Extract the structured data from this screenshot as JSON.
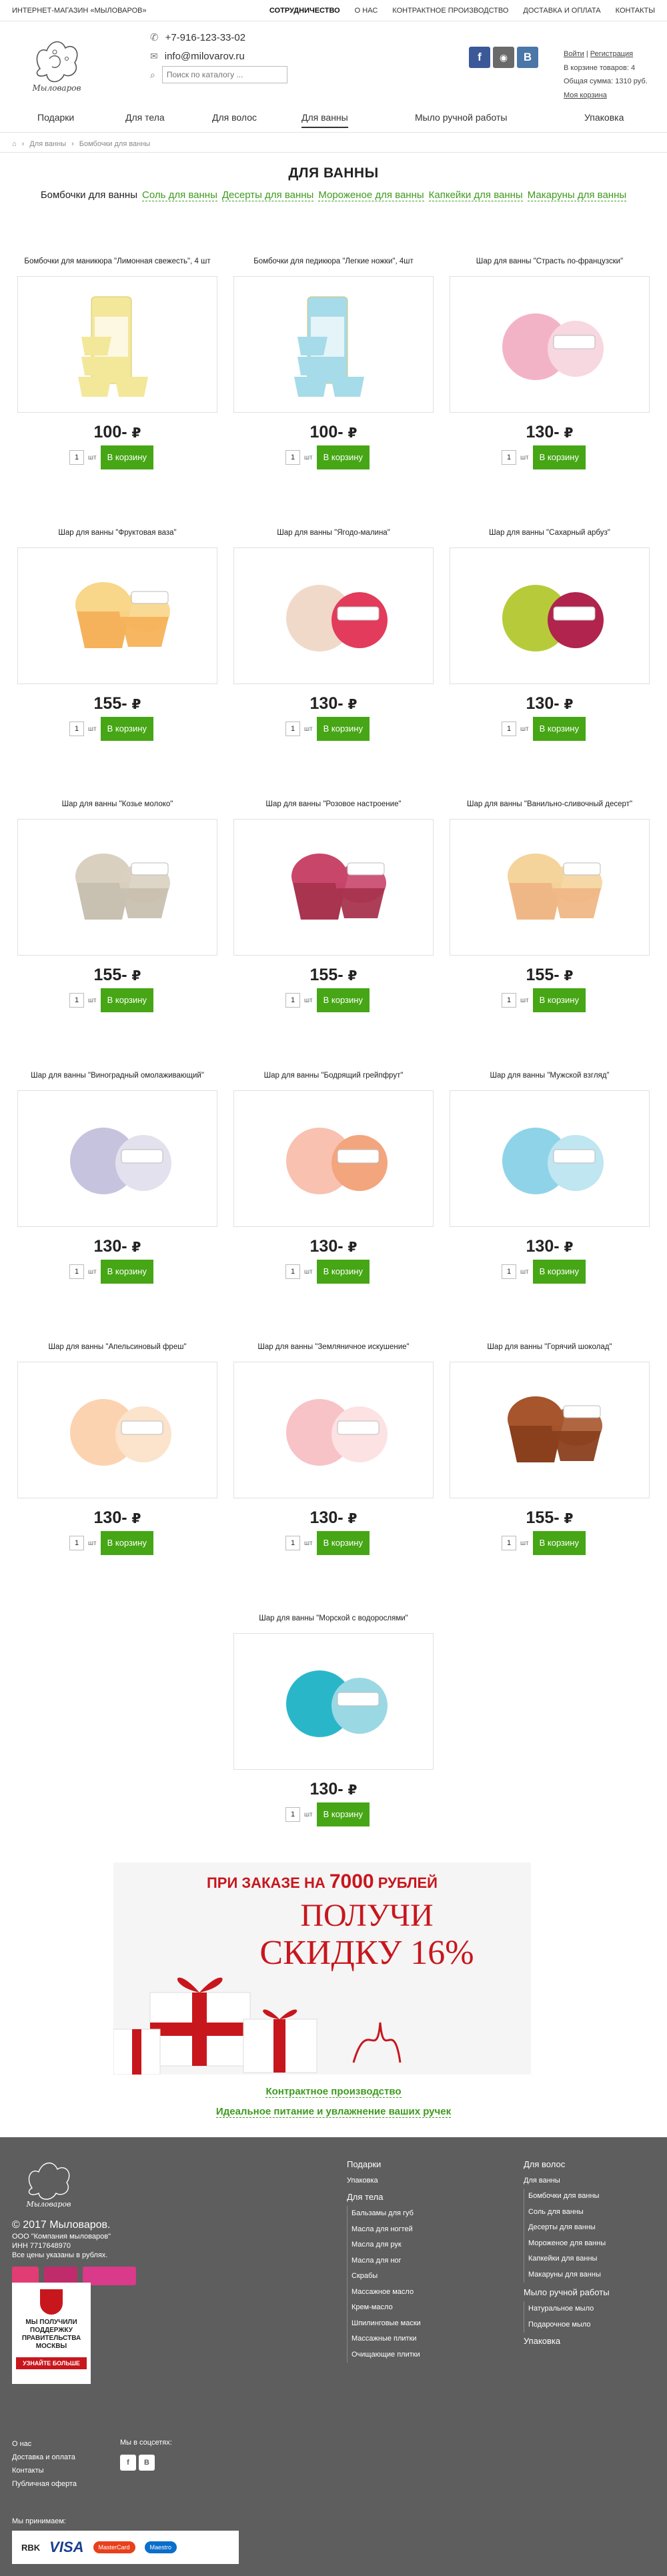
{
  "topbar": {
    "shop_name": "ИНТЕРНЕТ-МАГАЗИН «МЫЛОВАРОВ»",
    "nav": [
      "СОТРУДНИЧЕСТВО",
      "О НАС",
      "КОНТРАКТНОЕ ПРОИЗВОДСТВО",
      "ДОСТАВКА И ОПЛАТА",
      "КОНТАКТЫ"
    ]
  },
  "header": {
    "phone": "+7-916-123-33-02",
    "email": "info@milovarov.ru",
    "search_placeholder": "Поиск по каталогу ...",
    "login": "Войти",
    "register": "Регистрация",
    "cart_count": "В корзине товаров: 4",
    "cart_sum": "Общая сумма: 1310 руб.",
    "my_cart": "Моя корзина",
    "logo_text": "Мыловаров"
  },
  "mainnav": [
    "Подарки",
    "Для тела",
    "Для волос",
    "Для ванны",
    "Мыло ручной работы",
    "Упаковка"
  ],
  "breadcrumb": [
    "Для ванны",
    "Бомбочки для ванны"
  ],
  "page_title": "ДЛЯ ВАННЫ",
  "subnav": [
    "Бомбочки для ванны",
    "Соль для ванны",
    "Десерты для ванны",
    "Мороженое для ванны",
    "Капкейки для ванны",
    "Макаруны для ванны"
  ],
  "buy_label": "В корзину",
  "qty_default": "1",
  "unit_label": "шт",
  "currency": "₽",
  "products": [
    {
      "title": "Бомбочки для маникюра \"Лимонная свежесть\", 4 шт",
      "price": "100-"
    },
    {
      "title": "Бомбочки для педикюра \"Легкие ножки\", 4шт",
      "price": "100-"
    },
    {
      "title": "Шар для ванны \"Страсть по-французски\"",
      "price": "130-"
    },
    {
      "title": "Шар для ванны \"Фруктовая ваза\"",
      "price": "155-"
    },
    {
      "title": "Шар для ванны \"Ягодо-малина\"",
      "price": "130-"
    },
    {
      "title": "Шар для ванны \"Сахарный арбуз\"",
      "price": "130-"
    },
    {
      "title": "Шар для ванны \"Козье молоко\"",
      "price": "155-"
    },
    {
      "title": "Шар для ванны \"Розовое настроение\"",
      "price": "155-"
    },
    {
      "title": "Шар для ванны \"Ванильно-сливочный десерт\"",
      "price": "155-"
    },
    {
      "title": "Шар для ванны \"Виноградный омолаживающий\"",
      "price": "130-"
    },
    {
      "title": "Шар для ванны \"Бодрящий грейпфрут\"",
      "price": "130-"
    },
    {
      "title": "Шар для ванны \"Мужской взгляд\"",
      "price": "130-"
    },
    {
      "title": "Шар для ванны \"Апельсиновый фреш\"",
      "price": "130-"
    },
    {
      "title": "Шар для ванны \"Земляничное искушение\"",
      "price": "130-"
    },
    {
      "title": "Шар для ванны \"Горячий шоколад\"",
      "price": "155-"
    },
    {
      "title": "Шар для ванны \"Морской с водорослями\"",
      "price": "130-"
    }
  ],
  "banner": {
    "line1": "ПРИ ЗАКАЗЕ НА",
    "amount": "7000",
    "line1b": "РУБЛЕЙ",
    "line2": "ПОЛУЧИ",
    "line3": "СКИДКУ",
    "percent": "16%"
  },
  "bottom_links": [
    "Контрактное производство",
    "Идеальное питание и увлажнение ваших ручек"
  ],
  "footer": {
    "copyright": "© 2017 Мыловаров.",
    "company": "ООО \"Компания мыловаров\"",
    "inn": "ИНН 7717648970",
    "prices_note": "Все цены указаны в рублях.",
    "badge": "МЫ ПОЛУЧИЛИ ПОДДЕРЖКУ ПРАВИТЕЛЬСТВА МОСКВЫ",
    "badge_btn": "УЗНАЙТЕ БОЛЬШЕ",
    "bottom_links": [
      "О нас",
      "Доставка и оплата",
      "Контакты",
      "Публичная оферта"
    ],
    "social_title": "Мы в соцсетях:",
    "payments_title": "Мы принимаем:",
    "payments": [
      "RBK",
      "VISA",
      "MasterCard",
      "Maestro"
    ],
    "col1": {
      "head1": "Подарки",
      "head2": "Упаковка",
      "head3": "Для тела",
      "items": [
        "Бальзамы для губ",
        "Масла для ногтей",
        "Масла для рук",
        "Масла для ног",
        "Скрабы",
        "Массажное масло",
        "Крем-масло",
        "Шпилинговые маски",
        "Массажные плитки",
        "Очищающие плитки"
      ]
    },
    "col2": {
      "head1": "Для волос",
      "head2": "Для ванны",
      "items": [
        "Бомбочки для ванны",
        "Соль для ванны",
        "Десерты для ванны",
        "Мороженое для ванны",
        "Капкейки для ванны",
        "Макаруны для ванны"
      ],
      "head3": "Мыло ручной работы",
      "items2": [
        "Натуральное мыло",
        "Подарочное мыло"
      ],
      "head4": "Упаковка"
    }
  }
}
